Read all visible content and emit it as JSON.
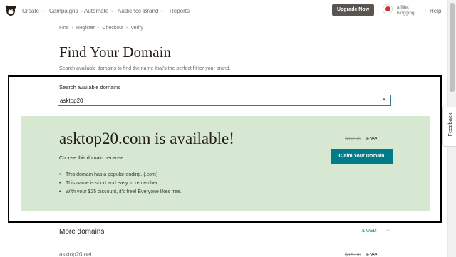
{
  "nav": {
    "items": [
      "Create",
      "Campaigns",
      "Automate",
      "Audience",
      "Brand",
      "Reports"
    ],
    "upgrade_label": "Upgrade Now",
    "account_name": "affiliet",
    "account_sub": "blogging",
    "help_label": "Help"
  },
  "feedback_label": "Feedback",
  "breadcrumb": [
    "Find",
    "Register",
    "Checkout",
    "Verify"
  ],
  "page": {
    "title": "Find Your Domain",
    "subtitle": "Search available domains to find the name that's the perfect fit for your brand."
  },
  "search": {
    "label": "Search available domains",
    "value": "asktop20"
  },
  "result": {
    "title": "asktop20.com is available!",
    "old_price": "$12.00",
    "new_price": "Free",
    "claim_label": "Claim Your Domain",
    "reason_heading": "Choose this domain because:",
    "reasons": [
      "This domain has a popular ending. (.com)",
      "This name is short and easy to remember.",
      "With your $25 discount, it's free! Everyone likes free."
    ]
  },
  "more": {
    "title": "More domains",
    "currency": "$ USD",
    "next_domain": "asktop20.net",
    "next_old_price": "$15.00",
    "next_new_price": "Free"
  },
  "colors": {
    "accent": "#007c89",
    "result_bg": "#d6e8d2",
    "upgrade_bg": "#5a5550"
  }
}
